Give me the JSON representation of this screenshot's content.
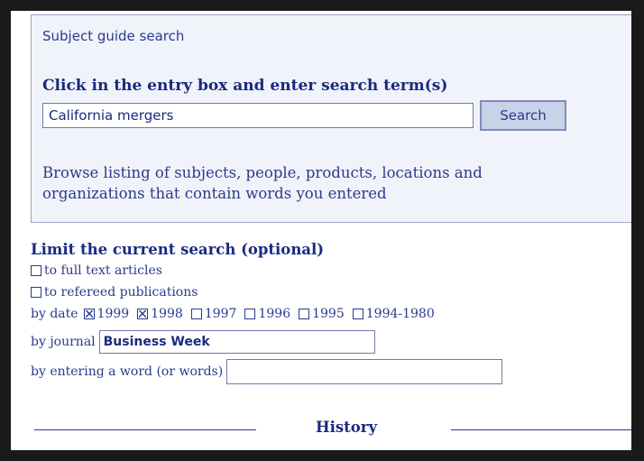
{
  "guide": {
    "title": "Subject guide search",
    "prompt": "Click in the entry box and enter search term(s)",
    "search_value": "California mergers",
    "search_button": "Search",
    "browse_line1": "Browse listing of subjects, people, products, locations and",
    "browse_line2": "organizations that contain words you entered"
  },
  "limit": {
    "title": "Limit the current search (optional)",
    "full_text": {
      "label": "to full text articles",
      "checked": false
    },
    "refereed": {
      "label": "to refereed publications",
      "checked": false
    },
    "date_label": "by date",
    "dates": [
      {
        "label": "1999",
        "checked": true
      },
      {
        "label": "1998",
        "checked": true
      },
      {
        "label": "1997",
        "checked": false
      },
      {
        "label": "1996",
        "checked": false
      },
      {
        "label": "1995",
        "checked": false
      },
      {
        "label": "1994-1980",
        "checked": false
      }
    ],
    "journal_label": "by journal",
    "journal_value": "Business Week",
    "words_label": "by entering a word (or words)",
    "words_value": ""
  },
  "history": {
    "label": "History"
  },
  "colors": {
    "text": "#2a3a8c",
    "panel": "#f1f3fa",
    "button": "#c8d3ea",
    "frame": "#1a1a1a"
  }
}
